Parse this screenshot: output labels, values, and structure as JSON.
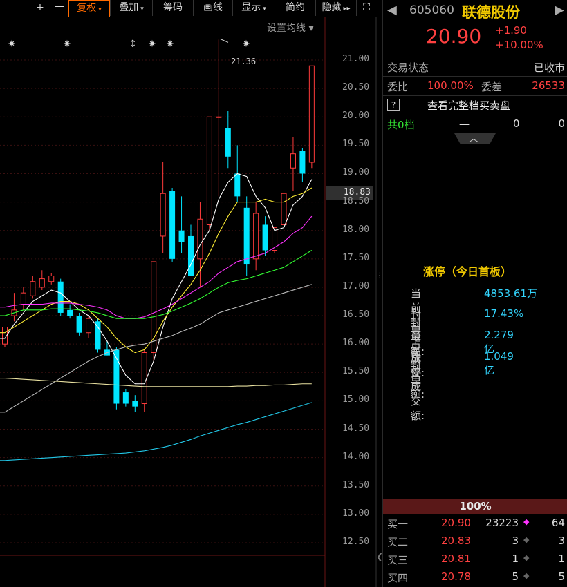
{
  "toolbar": {
    "plus": "+",
    "minus": "一",
    "items": [
      {
        "label": "复权",
        "arrow": "▾"
      },
      {
        "label": "叠加",
        "arrow": "▾"
      },
      {
        "label": "筹码",
        "arrow": ""
      },
      {
        "label": "画线",
        "arrow": ""
      },
      {
        "label": "显示",
        "arrow": "▾"
      },
      {
        "label": "简约",
        "arrow": ""
      },
      {
        "label": "隐藏",
        "arrow": "▸▸"
      }
    ],
    "expand_icon": "⛶"
  },
  "chart": {
    "settings_label": "设置均线 ▾",
    "high_label": "21.36",
    "current_price_tag": "18.83",
    "y_ticks": [
      "21.00",
      "20.50",
      "20.00",
      "19.50",
      "19.00",
      "18.50",
      "18.00",
      "17.50",
      "17.00",
      "16.50",
      "16.00",
      "15.50",
      "15.00",
      "14.50",
      "14.00",
      "13.50",
      "13.00",
      "12.50"
    ]
  },
  "chart_data": {
    "type": "candlestick",
    "ylim": [
      12.3,
      21.6
    ],
    "candles": [
      {
        "o": 16.0,
        "h": 16.3,
        "l": 15.95,
        "c": 16.3
      },
      {
        "o": 16.5,
        "h": 16.9,
        "l": 16.4,
        "c": 16.6
      },
      {
        "o": 16.7,
        "h": 17.0,
        "l": 16.6,
        "c": 16.9
      },
      {
        "o": 16.85,
        "h": 17.2,
        "l": 16.8,
        "c": 17.1
      },
      {
        "o": 17.0,
        "h": 17.3,
        "l": 16.95,
        "c": 17.15
      },
      {
        "o": 17.1,
        "h": 17.25,
        "l": 17.05,
        "c": 17.2
      },
      {
        "o": 17.1,
        "h": 17.15,
        "l": 16.5,
        "c": 16.55
      },
      {
        "o": 16.6,
        "h": 16.7,
        "l": 16.45,
        "c": 16.5
      },
      {
        "o": 16.5,
        "h": 16.55,
        "l": 16.15,
        "c": 16.2
      },
      {
        "o": 16.2,
        "h": 16.5,
        "l": 16.1,
        "c": 16.45
      },
      {
        "o": 16.4,
        "h": 16.45,
        "l": 15.85,
        "c": 15.9
      },
      {
        "o": 15.9,
        "h": 16.05,
        "l": 15.8,
        "c": 15.8
      },
      {
        "o": 15.9,
        "h": 15.95,
        "l": 14.85,
        "c": 14.95
      },
      {
        "o": 15.15,
        "h": 15.2,
        "l": 14.9,
        "c": 14.95
      },
      {
        "o": 15.0,
        "h": 15.1,
        "l": 14.8,
        "c": 14.9
      },
      {
        "o": 14.95,
        "h": 15.9,
        "l": 14.8,
        "c": 15.85
      },
      {
        "o": 15.85,
        "h": 17.45,
        "l": 15.7,
        "c": 17.45
      },
      {
        "o": 17.9,
        "h": 19.2,
        "l": 17.6,
        "c": 18.65
      },
      {
        "o": 18.7,
        "h": 18.75,
        "l": 17.45,
        "c": 17.5
      },
      {
        "o": 18.0,
        "h": 18.6,
        "l": 17.6,
        "c": 17.8
      },
      {
        "o": 17.9,
        "h": 18.1,
        "l": 17.2,
        "c": 17.2
      },
      {
        "o": 17.5,
        "h": 18.5,
        "l": 17.0,
        "c": 18.2
      },
      {
        "o": 18.1,
        "h": 20.0,
        "l": 18.0,
        "c": 20.0
      },
      {
        "o": 20.0,
        "h": 21.36,
        "l": 18.6,
        "c": 20.0
      },
      {
        "o": 19.8,
        "h": 20.1,
        "l": 19.1,
        "c": 19.3
      },
      {
        "o": 19.0,
        "h": 19.5,
        "l": 18.5,
        "c": 18.6
      },
      {
        "o": 18.4,
        "h": 18.6,
        "l": 17.2,
        "c": 17.4
      },
      {
        "o": 17.5,
        "h": 18.5,
        "l": 17.3,
        "c": 18.3
      },
      {
        "o": 18.1,
        "h": 18.25,
        "l": 17.55,
        "c": 17.65
      },
      {
        "o": 17.65,
        "h": 18.05,
        "l": 17.6,
        "c": 18.05
      },
      {
        "o": 18.1,
        "h": 19.2,
        "l": 18.0,
        "c": 18.65
      },
      {
        "o": 19.1,
        "h": 19.65,
        "l": 18.7,
        "c": 19.35
      },
      {
        "o": 19.4,
        "h": 19.45,
        "l": 18.85,
        "c": 19.0
      },
      {
        "o": 19.2,
        "h": 20.9,
        "l": 19.1,
        "c": 20.9
      }
    ],
    "ma": [
      {
        "color": "#ffffff",
        "values": [
          16.1,
          16.35,
          16.55,
          16.75,
          16.85,
          16.95,
          16.9,
          16.75,
          16.6,
          16.5,
          16.3,
          16.05,
          15.75,
          15.45,
          15.3,
          15.3,
          15.7,
          16.3,
          16.8,
          17.1,
          17.4,
          17.75,
          18.0,
          18.55,
          18.85,
          19.0,
          18.95,
          18.6,
          18.4,
          18.0,
          18.05,
          18.45,
          18.6,
          18.9
        ]
      },
      {
        "color": "#ffee33",
        "values": [
          16.2,
          16.3,
          16.4,
          16.5,
          16.6,
          16.7,
          16.75,
          16.75,
          16.7,
          16.6,
          16.45,
          16.3,
          16.1,
          15.95,
          15.85,
          15.9,
          16.1,
          16.4,
          16.65,
          16.85,
          17.05,
          17.3,
          17.6,
          17.95,
          18.25,
          18.5,
          18.5,
          18.5,
          18.55,
          18.5,
          18.5,
          18.6,
          18.65,
          18.75
        ]
      },
      {
        "color": "#ff33ff",
        "values": [
          16.65,
          16.68,
          16.7,
          16.7,
          16.7,
          16.72,
          16.72,
          16.72,
          16.7,
          16.68,
          16.65,
          16.6,
          16.5,
          16.45,
          16.45,
          16.48,
          16.55,
          16.62,
          16.7,
          16.8,
          16.9,
          17.0,
          17.1,
          17.25,
          17.35,
          17.45,
          17.5,
          17.55,
          17.6,
          17.7,
          17.8,
          17.95,
          18.05,
          18.25
        ]
      },
      {
        "color": "#33ff33",
        "values": [
          16.5,
          16.55,
          16.6,
          16.6,
          16.6,
          16.62,
          16.62,
          16.62,
          16.6,
          16.58,
          16.55,
          16.5,
          16.45,
          16.45,
          16.45,
          16.45,
          16.48,
          16.52,
          16.58,
          16.65,
          16.72,
          16.8,
          16.9,
          17.0,
          17.08,
          17.12,
          17.15,
          17.2,
          17.25,
          17.3,
          17.35,
          17.45,
          17.55,
          17.65
        ]
      },
      {
        "color": "#bbbbbb",
        "values": [
          14.8,
          14.9,
          15.0,
          15.1,
          15.2,
          15.3,
          15.4,
          15.5,
          15.6,
          15.7,
          15.78,
          15.85,
          15.9,
          15.95,
          15.98,
          16.0,
          16.05,
          16.1,
          16.15,
          16.22,
          16.28,
          16.35,
          16.45,
          16.55,
          16.6,
          16.65,
          16.7,
          16.75,
          16.8,
          16.85,
          16.9,
          16.95,
          17.0,
          17.05
        ]
      },
      {
        "color": "#e8e0a0",
        "values": [
          15.4,
          15.39,
          15.38,
          15.37,
          15.36,
          15.35,
          15.34,
          15.33,
          15.32,
          15.31,
          15.3,
          15.29,
          15.28,
          15.27,
          15.26,
          15.25,
          15.25,
          15.25,
          15.25,
          15.25,
          15.25,
          15.25,
          15.25,
          15.25,
          15.25,
          15.26,
          15.26,
          15.27,
          15.27,
          15.28,
          15.28,
          15.29,
          15.3,
          15.3
        ]
      },
      {
        "color": "#22c8e8",
        "values": [
          13.95,
          13.96,
          13.97,
          13.98,
          13.99,
          14.0,
          14.01,
          14.02,
          14.03,
          14.04,
          14.05,
          14.06,
          14.07,
          14.08,
          14.1,
          14.12,
          14.15,
          14.18,
          14.22,
          14.27,
          14.32,
          14.38,
          14.43,
          14.48,
          14.53,
          14.58,
          14.62,
          14.67,
          14.72,
          14.77,
          14.82,
          14.87,
          14.92,
          14.97
        ]
      }
    ]
  },
  "stock": {
    "code": "605060",
    "name": "联德股份",
    "price": "20.90",
    "change": "+1.90",
    "change_pct": "+10.00%",
    "prev_icon": "◀",
    "next_icon": "▶"
  },
  "status": {
    "trade_label": "交易状态",
    "trade_value": "已收市",
    "ratio_label": "委比",
    "ratio_value": "100.00%",
    "diff_label": "委差",
    "diff_value": "26533",
    "help_icon": "?",
    "full_depth_link": "查看完整档买卖盘",
    "total_label": "共0档",
    "total_dash": "一",
    "total_v1": "0",
    "total_v2": "0",
    "collapse_icon": "︿"
  },
  "limit_up": {
    "title": "涨停（今日首板）",
    "rows": [
      {
        "label": "当前封单额:",
        "value": "4853.61万"
      },
      {
        "label": "封单占成交:",
        "value": "17.43%"
      },
      {
        "label": "最高封单额:",
        "value": "2.279亿"
      },
      {
        "label": "涨停成交额:",
        "value": "1.049亿"
      }
    ]
  },
  "orderbook": {
    "bar_label": "100%",
    "rows": [
      {
        "label": "买一",
        "price": "20.90",
        "vol": "23223",
        "marker": "◆",
        "count": "64",
        "highlight": true
      },
      {
        "label": "买二",
        "price": "20.83",
        "vol": "3",
        "marker": "◆",
        "count": "3",
        "highlight": false
      },
      {
        "label": "买三",
        "price": "20.81",
        "vol": "1",
        "marker": "◆",
        "count": "1",
        "highlight": false
      },
      {
        "label": "买四",
        "price": "20.78",
        "vol": "5",
        "marker": "◆",
        "count": "5",
        "highlight": false
      }
    ]
  }
}
